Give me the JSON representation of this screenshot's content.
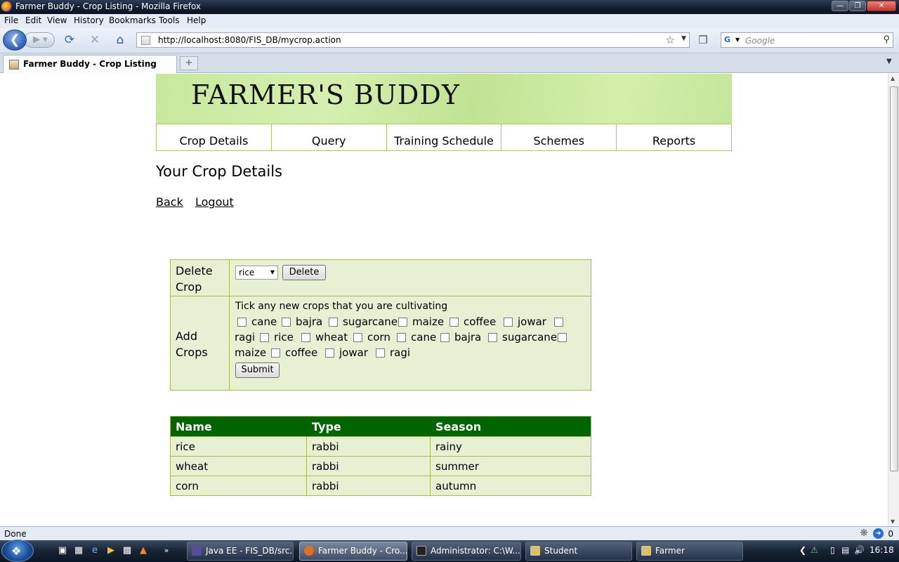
{
  "window": {
    "title": "Farmer Buddy - Crop Listing - Mozilla Firefox"
  },
  "menubar": [
    "File",
    "Edit",
    "View",
    "History",
    "Bookmarks",
    "Tools",
    "Help"
  ],
  "toolbar": {
    "url": "http://localhost:8080/FIS_DB/mycrop.action",
    "search_placeholder": "Google"
  },
  "tab": {
    "label": "Farmer Buddy - Crop Listing"
  },
  "site": {
    "banner_title": "FARMER'S BUDDY",
    "nav": [
      "Crop Details",
      "Query",
      "Training Schedule",
      "Schemes",
      "Reports"
    ],
    "page_title": "Your Crop Details",
    "links": {
      "back": "Back",
      "logout": "Logout"
    }
  },
  "delete_form": {
    "label_line1": "Delete",
    "label_line2": "Crop",
    "selected": "rice",
    "button": "Delete"
  },
  "add_form": {
    "label_line1": "Add",
    "label_line2": "Crops",
    "instruction": "Tick any new crops that you are cultivating",
    "crops": [
      "cane",
      "bajra",
      "sugarcane",
      "maize",
      "coffee",
      "jowar",
      "ragi",
      "rice",
      "wheat",
      "corn",
      "cane",
      "bajra",
      "sugarcane",
      "maize",
      "coffee",
      "jowar",
      "ragi"
    ],
    "button": "Submit"
  },
  "crop_table": {
    "headers": [
      "Name",
      "Type",
      "Season"
    ],
    "rows": [
      [
        "rice",
        "rabbi",
        "rainy"
      ],
      [
        "wheat",
        "rabbi",
        "summer"
      ],
      [
        "corn",
        "rabbi",
        "autumn"
      ]
    ]
  },
  "status": {
    "text": "Done",
    "count": "0"
  },
  "taskbar": {
    "buttons": [
      "Java EE - FIS_DB/src...",
      "Farmer Buddy - Cro...",
      "Administrator: C:\\W...",
      "Student",
      "Farmer"
    ],
    "clock": "16:18"
  }
}
